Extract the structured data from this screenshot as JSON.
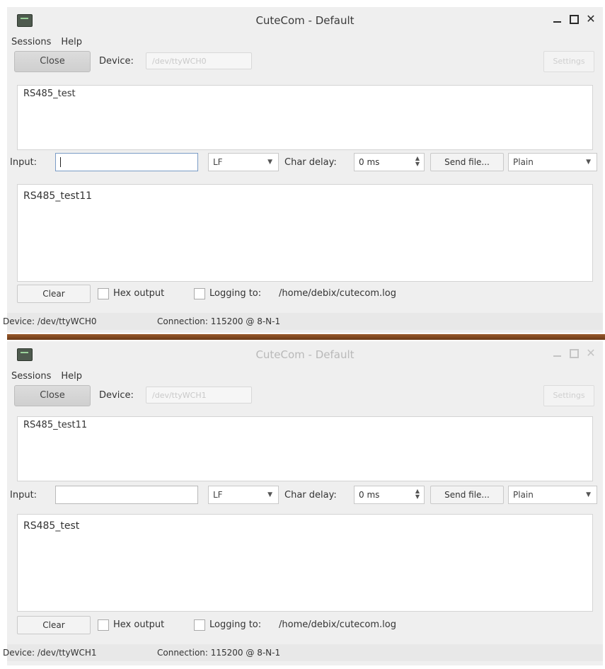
{
  "windows": [
    {
      "title": "CuteCom - Default",
      "menu": {
        "sessions": "Sessions",
        "help": "Help"
      },
      "toolbar": {
        "close_label": "Close",
        "device_label": "Device:",
        "device_value": "/dev/ttyWCH0",
        "settings_label": "Settings"
      },
      "received_text": "RS485_test",
      "input": {
        "label": "Input:",
        "value": "",
        "line_ending": "LF",
        "char_delay_label": "Char delay:",
        "char_delay_value": "0 ms",
        "send_file_label": "Send file...",
        "format": "Plain"
      },
      "sent_text": "RS485_test11",
      "bottom": {
        "clear_label": "Clear",
        "hex_output_label": "Hex output",
        "logging_label": "Logging to:",
        "log_path": "/home/debix/cutecom.log"
      },
      "status": {
        "device": "Device: /dev/ttyWCH0",
        "connection": "Connection: 115200 @ 8-N-1"
      }
    },
    {
      "title": "CuteCom - Default",
      "menu": {
        "sessions": "Sessions",
        "help": "Help"
      },
      "toolbar": {
        "close_label": "Close",
        "device_label": "Device:",
        "device_value": "/dev/ttyWCH1",
        "settings_label": "Settings"
      },
      "received_text": "RS485_test11",
      "input": {
        "label": "Input:",
        "value": "",
        "line_ending": "LF",
        "char_delay_label": "Char delay:",
        "char_delay_value": "0 ms",
        "send_file_label": "Send file...",
        "format": "Plain"
      },
      "sent_text": "RS485_test",
      "bottom": {
        "clear_label": "Clear",
        "hex_output_label": "Hex output",
        "logging_label": "Logging to:",
        "log_path": "/home/debix/cutecom.log"
      },
      "status": {
        "device": "Device: /dev/ttyWCH1",
        "connection": "Connection: 115200 @ 8-N-1"
      }
    }
  ],
  "colors": {
    "separator": "#7a4420",
    "window_bg": "#efefef",
    "focus_border": "#7a9cc6"
  }
}
